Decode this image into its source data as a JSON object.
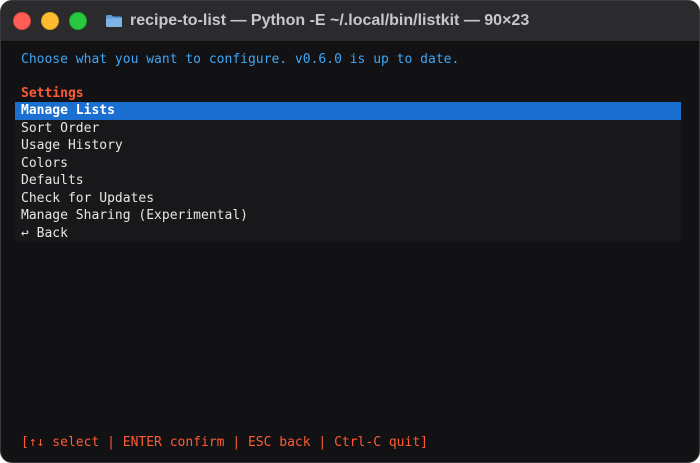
{
  "window": {
    "title": "recipe-to-list — Python -E ~/.local/bin/listkit — 90×23",
    "folder_icon": "folder-icon"
  },
  "terminal": {
    "header": "Choose what you want to configure. v0.6.0 is up to date.",
    "section_title": "Settings",
    "menu": {
      "selected_index": 0,
      "items": [
        {
          "label": "Manage Lists"
        },
        {
          "label": "Sort Order"
        },
        {
          "label": "Usage History"
        },
        {
          "label": "Colors"
        },
        {
          "label": "Defaults"
        },
        {
          "label": "Check for Updates"
        },
        {
          "label": "Manage Sharing (Experimental)"
        },
        {
          "label": "↩ Back"
        }
      ]
    },
    "footer": "[↑↓ select | ENTER confirm | ESC back | Ctrl-C quit]"
  },
  "colors": {
    "header_text": "#3fa6f5",
    "accent_red": "#ff5a36",
    "selection": "#1a6fd1",
    "background": "#121214"
  }
}
